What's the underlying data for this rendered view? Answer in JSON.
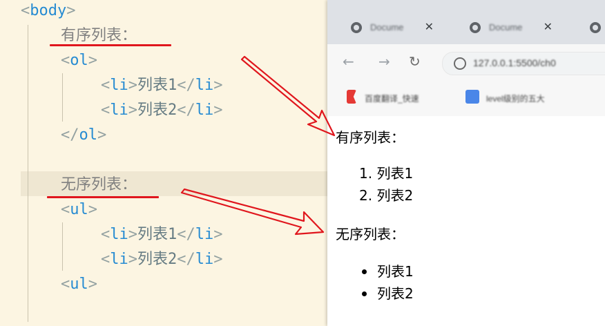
{
  "editor": {
    "body_open": "body",
    "ordered_comment": "有序列表：",
    "ol_tag": "ol",
    "li_tag": "li",
    "ol_items": [
      "列表1",
      "列表2"
    ],
    "ol_close": "ol",
    "unordered_comment": "无序列表：",
    "ul_tag": "ul",
    "ul_items": [
      "列表1",
      "列表2"
    ],
    "ul_close_last": "ul"
  },
  "browser": {
    "tabs": [
      {
        "title": "Docume",
        "close": "✕"
      },
      {
        "title": "Docume",
        "close": "✕"
      },
      {
        "title": ""
      }
    ],
    "nav": {
      "back": "←",
      "forward": "→",
      "reload": "↻"
    },
    "url": "127.0.0.1:5500/ch0",
    "bookmarks": [
      {
        "label": "百度翻译_快速",
        "icon_color": "#e53935"
      },
      {
        "label": "level级别的五大",
        "icon_color": "#4a86e8"
      }
    ],
    "page": {
      "ordered_heading": "有序列表：",
      "ordered_items": [
        "1. 列表1",
        "2. 列表2"
      ],
      "unordered_heading": "无序列表：",
      "unordered_items": [
        "列表1",
        "列表2"
      ]
    }
  },
  "colors": {
    "tag": "#268bd2",
    "punct": "#93a1a1",
    "annotation_red": "#e0161d",
    "editor_bg": "#fcf5e2"
  }
}
